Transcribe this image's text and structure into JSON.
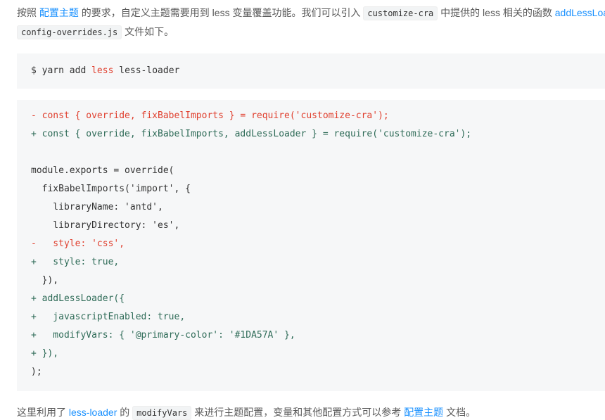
{
  "intro": {
    "line1": {
      "text_before_link": "按照",
      "theme_link": "配置主题",
      "text_mid": "的要求，自定义主题需要用到 less 变量覆盖功能。我们可以引入",
      "code_customize_cra": "customize-cra",
      "text_after_code": "中提供的 less 相关的函数",
      "loader_link": "addLessLoad"
    },
    "line2": {
      "code_config_file": "config-overrides.js",
      "text_after_code": "文件如下。"
    }
  },
  "install_block": {
    "command": "$ yarn add",
    "package_less": "less",
    "package_less_loader": "less-loader"
  },
  "code_block": {
    "lines": [
      "- const { override, fixBabelImports } = require('customize-cra');",
      "+ const { override, fixBabelImports, addLessLoader } = require('customize-cra');",
      "",
      "module.exports = override(",
      "  fixBabelImports('import', {",
      "    libraryName: 'antd',",
      "    libraryDirectory: 'es',",
      "-   style: 'css',",
      "+   style: true,",
      "  }),",
      "+ addLessLoader({",
      "+   javascriptEnabled: true,",
      "+   modifyVars: { '@primary-color': '#1DA57A' },",
      "+ }),",
      ");"
    ]
  },
  "outro": {
    "text_before_link": "这里利用了",
    "less_loader_link": "less-loader",
    "text_mid": "的",
    "code_modify_vars": "modifyVars",
    "text_after_code": "来进行主题配置，变量和其他配置方式可以参考",
    "theme_link": "配置主题",
    "text_end": "文档。"
  },
  "colors": {
    "text": "#595959",
    "link": "#1890ff",
    "code_text": "#333333",
    "code_background": "#f6f7f8",
    "diff_deleted": "#e0402f",
    "diff_inserted": "#2e6b57"
  }
}
